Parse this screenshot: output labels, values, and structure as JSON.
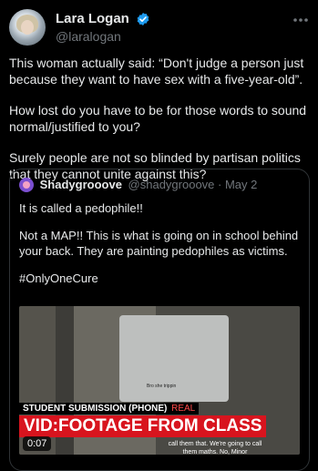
{
  "tweet": {
    "display_name": "Lara Logan",
    "handle": "@laralogan",
    "paragraphs": [
      "This woman actually said: “Don't judge a person just because they want to have sex with a five-year-old”.",
      "How lost do you have to be for those words to sound normal/justified to you?",
      "Surely people are not so blinded by partisan politics that they cannot unite against this?"
    ]
  },
  "icons": {
    "verified": "verified-badge-icon",
    "more": "more-icon"
  },
  "colors": {
    "background": "#000000",
    "text": "#e7e9ea",
    "secondary": "#71767b",
    "verified": "#1d9bf0",
    "banner_red": "#d8141e"
  },
  "quote": {
    "display_name": "Shadygrooove",
    "handle_date": "@shadygrooove · May 2",
    "paragraphs": [
      "It is called a pedophile!!",
      "Not a MAP!! This is what is going on in school behind your back. They are painting pedophiles as victims.",
      "#OnlyOneCure"
    ],
    "video": {
      "lower_third_top": "STUDENT SUBMISSION (PHONE)",
      "lower_third_tag": "REAL",
      "lower_third_main": "VID:FOOTAGE FROM CLASS",
      "caption": "call them that. We're going to call them maths. No, Minor",
      "phone_label": "Bro she trippin",
      "duration": "0:07"
    }
  }
}
